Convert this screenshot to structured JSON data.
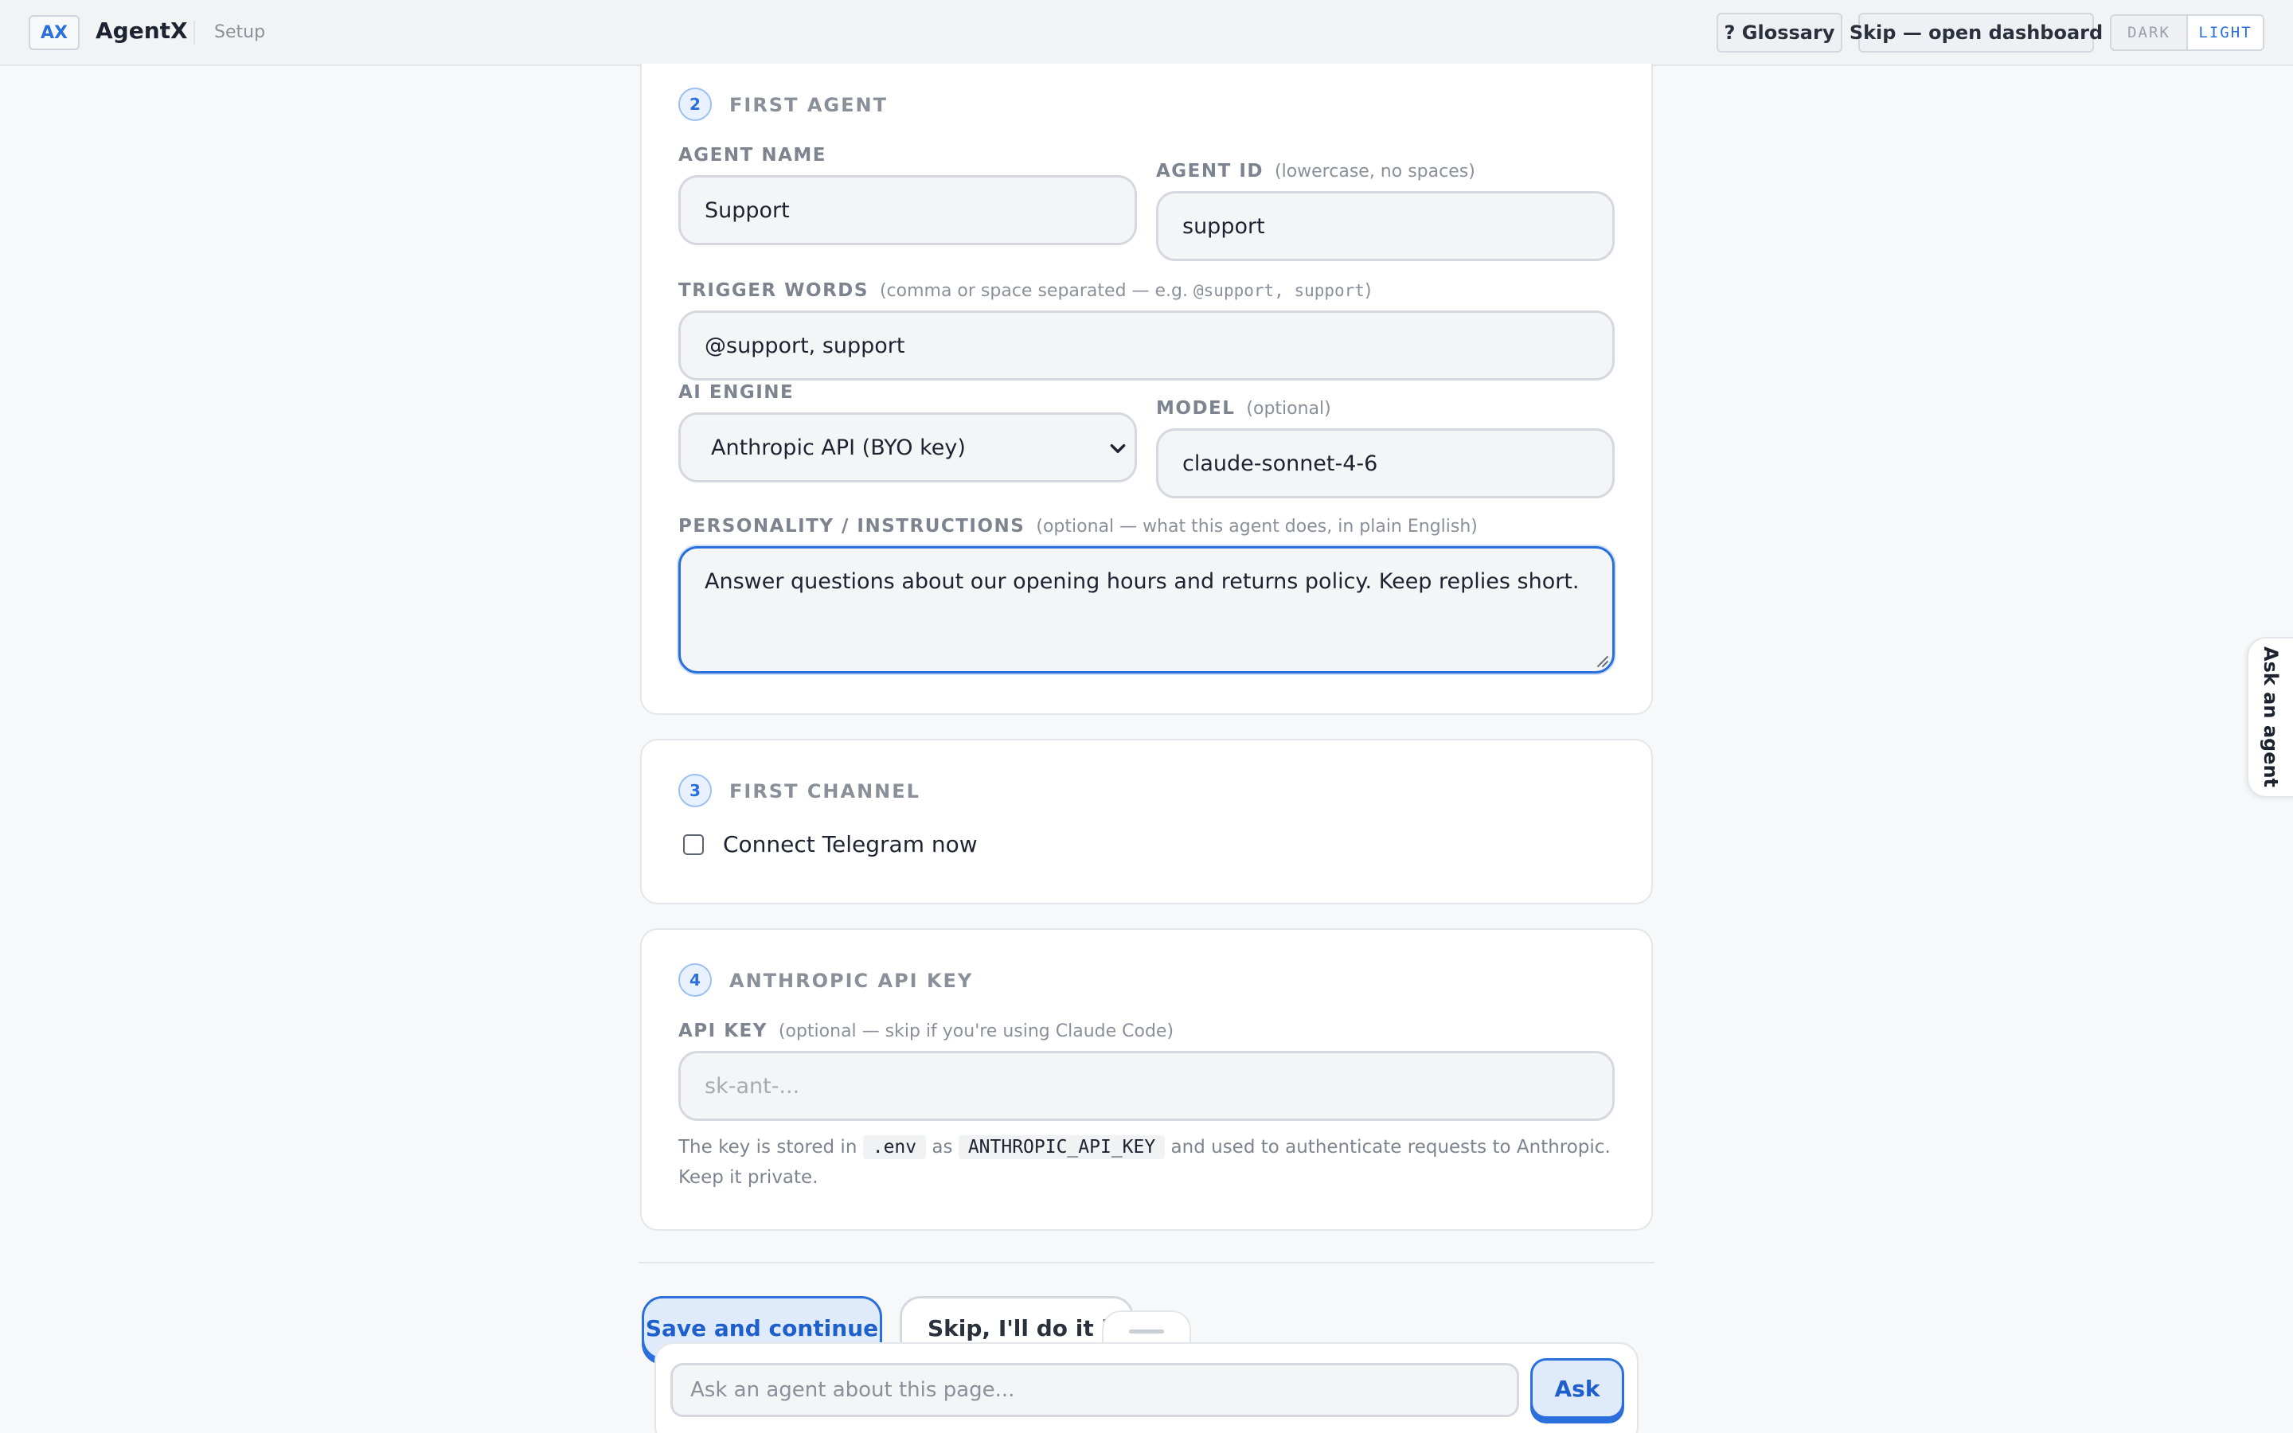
{
  "header": {
    "logo_text": "AX",
    "app_name": "AgentX",
    "crumb": "Setup",
    "glossary_label": "? Glossary",
    "skip_dashboard_label": "Skip — open dashboard",
    "theme": {
      "dark_label": "DARK",
      "light_label": "LIGHT",
      "selected": "LIGHT"
    }
  },
  "first_agent": {
    "step": "2",
    "title": "FIRST AGENT",
    "agent_name": {
      "label": "AGENT NAME",
      "value": "Support"
    },
    "agent_id": {
      "label": "AGENT ID",
      "hint": "(lowercase, no spaces)",
      "value": "support"
    },
    "trigger_words": {
      "label": "TRIGGER WORDS",
      "hint_prefix": "(comma or space separated — e.g. ",
      "hint_example": "@support, support",
      "hint_suffix": ")",
      "value": "@support, support"
    },
    "ai_engine": {
      "label": "AI ENGINE",
      "value": "Anthropic API (BYO key)"
    },
    "model": {
      "label": "MODEL",
      "hint": "(optional)",
      "value": "claude-sonnet-4-6"
    },
    "personality": {
      "label": "PERSONALITY / INSTRUCTIONS",
      "hint": "(optional — what this agent does, in plain English)",
      "value": "Answer questions about our opening hours and returns policy. Keep replies short."
    }
  },
  "first_channel": {
    "step": "3",
    "title": "FIRST CHANNEL",
    "telegram_label": "Connect Telegram now",
    "telegram_checked": false
  },
  "api_key_section": {
    "step": "4",
    "title": "ANTHROPIC API KEY",
    "api_key": {
      "label": "API KEY",
      "hint": "(optional — skip if you're using Claude Code)",
      "placeholder": "sk-ant-..."
    },
    "help": {
      "part1": "The key is stored in ",
      "code1": ".env",
      "part2": " as ",
      "code2": "ANTHROPIC_API_KEY",
      "part3": " and used to authenticate requests to Anthropic. Keep it private."
    }
  },
  "actions": {
    "save_label": "Save and continue",
    "skip_label": "Skip, I'll do it later"
  },
  "ask": {
    "placeholder": "Ask an agent about this page...",
    "button_label": "Ask",
    "side_tab_label": "Ask an agent"
  },
  "colors": {
    "accent": "#2a6fdb",
    "accent_bg": "#dfeafb",
    "page_bg": "#f7f8fa"
  }
}
